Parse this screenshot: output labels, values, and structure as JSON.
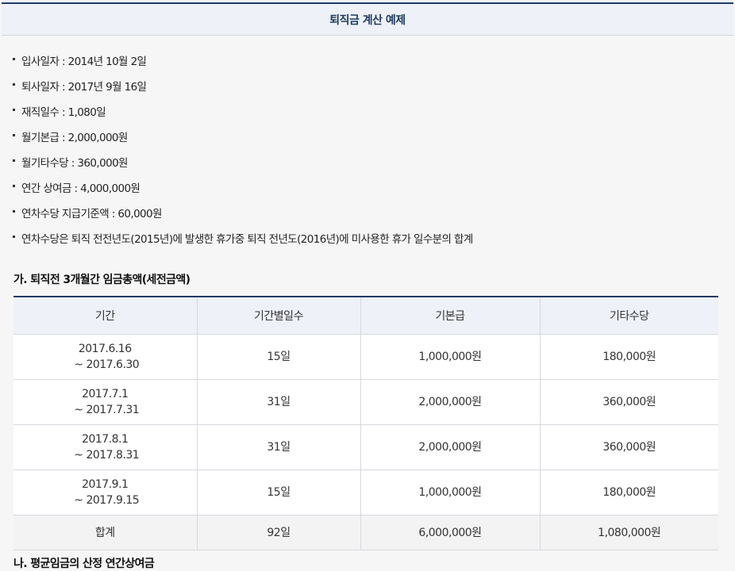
{
  "header": {
    "title": "퇴직금 계산 예제"
  },
  "info": [
    "입사일자 : 2014년 10월 2일",
    "퇴사일자 : 2017년 9월 16일",
    "재직일수 : 1,080일",
    "월기본급 : 2,000,000원",
    "월기타수당 : 360,000원",
    "연간 상여금 : 4,000,000원",
    "연차수당 지급기준액 : 60,000원",
    "연차수당은 퇴직 전전년도(2015년)에 발생한 휴가중 퇴직 전년도(2016년)에 미사용한 휴가 일수분의 합계"
  ],
  "section_a": {
    "title": "가. 퇴직전 3개월간 임금총액(세전금액)",
    "columns": [
      "기간",
      "기간별일수",
      "기본급",
      "기타수당"
    ],
    "rows": [
      {
        "from": "2017.6.16",
        "to": "~ 2017.6.30",
        "days": "15일",
        "base": "1,000,000원",
        "other": "180,000원"
      },
      {
        "from": "2017.7.1",
        "to": "~ 2017.7.31",
        "days": "31일",
        "base": "2,000,000원",
        "other": "360,000원"
      },
      {
        "from": "2017.8.1",
        "to": "~ 2017.8.31",
        "days": "31일",
        "base": "2,000,000원",
        "other": "360,000원"
      },
      {
        "from": "2017.9.1",
        "to": "~ 2017.9.15",
        "days": "15일",
        "base": "1,000,000원",
        "other": "180,000원"
      }
    ],
    "total": {
      "label": "합계",
      "days": "92일",
      "base": "6,000,000원",
      "other": "1,080,000원"
    }
  },
  "section_b": {
    "title": "나. 평균임금의 산정 연간상여금"
  },
  "colors": {
    "navy": "#1f3a66",
    "header_bg": "#eef2f8",
    "border": "#d5d9df"
  }
}
